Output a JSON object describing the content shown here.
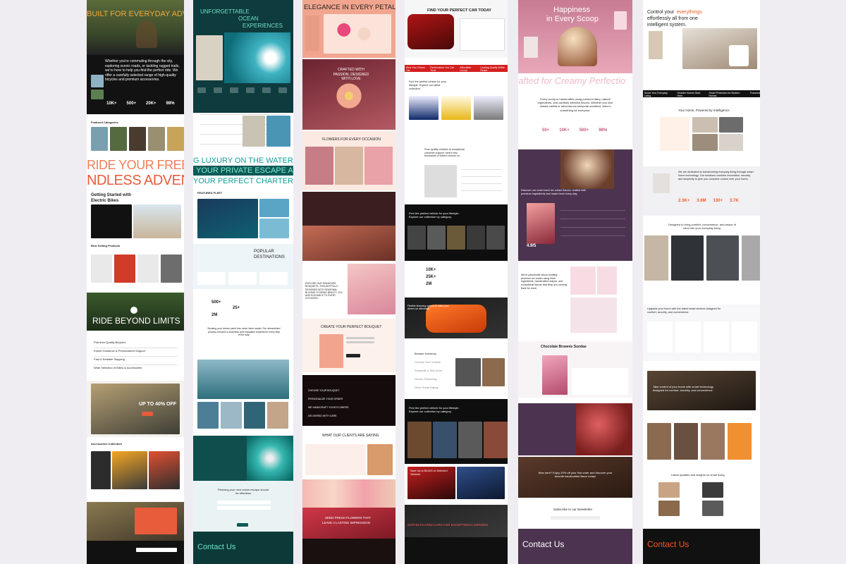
{
  "col1": {
    "hero": "BUILT FOR EVERYDAY ADVENT",
    "intro": "Whether you're commuting through the city, exploring scenic roads, or tackling rugged trails, we're here to help you find the perfect ride. We offer a carefully selected range of high-quality bicycles and premium accessories.",
    "stats": [
      "10K+",
      "500+",
      "20K+",
      "98%"
    ],
    "featured": "Featured Categories",
    "marquee1": "RIDE YOUR FREE",
    "marquee2": "NDLESS ADVEN",
    "getting_started": "Getting Started with Electric Bikes",
    "best_selling": "Best Selling Products",
    "ride_beyond": "RIDE BEYOND LIMITS",
    "why_list": [
      "Premium Quality Bicycles",
      "Expert Guidance & Personalized Support",
      "Fast & Reliable Shipping",
      "Wide Selection of Bikes & Accessories"
    ],
    "promo": "UP TO 40% OFF",
    "accessories": "Accessories Collection"
  },
  "col2": {
    "hero1": "UNFORGETTABLE",
    "hero2": "OCEAN",
    "hero3": "EXPERIENCES",
    "marquee1": "G LUXURY ON THE WATER",
    "marquee2": "YOUR PRIVATE ESCAPE AW",
    "marquee3": "YOUR PERFECT CHARTER",
    "fleet": "FEATURED FLEET",
    "popular1": "POPULAR",
    "popular2": "DESTINATIONS",
    "stats": [
      "500+",
      "25+",
      "2M"
    ],
    "booking": "Booking your dream yacht has never been easier. Our streamlined process ensures a seamless and enjoyable experience every step of the way.",
    "plan": "Planning your next ocean escape should be effortless",
    "contact": "Contact Us"
  },
  "col3": {
    "hero": "ELEGANCE IN EVERY PETAL",
    "crafted": "CRAFTED WITH PASSION, DESIGNED WITH LOVE",
    "occasion": "FLOWERS FOR EVERY OCCASION",
    "explore": "EXPLORE OUR SIGNATURE BOUQUETS, THOUGHTFULLY DESIGNED WITH SEASONAL BLOOMS TO BRING BEAUTY, JOY, AND ELEGANCE TO EVERY OCCASION.",
    "bouquet": "CREATE YOUR PERFECT BOUQUET",
    "steps": [
      "CHOOSE YOUR BOUQUET",
      "PERSONALIZE YOUR ORDER",
      "WE HANDCRAFT YOUR FLOWERS",
      "DELIVERED WITH CARE"
    ],
    "clients": "WHAT OUR CLIENTS ARE SAYING",
    "send1": "SEND FRESH FLOWERS THAT",
    "send2": "LEAVE A LASTING IMPRESSION"
  },
  "col4": {
    "hero": "FIND YOUR PERFECT CAR TODAY",
    "ticker": [
      "Rent Your Dream Car",
      "Performance You Can Trust",
      "Affordable Luxury",
      "Leading Quality Within Reach",
      "Premium Cars"
    ],
    "find": "Find the perfect vehicle for your lifestyle. Explore our latest collection.",
    "trusted": "From quality vehicles to exceptional customer support, here's why thousands of drivers choose us.",
    "lifestyle": "Find the perfect vehicle for your lifestyle. Explore our collection by category.",
    "stats": [
      "10K+",
      "25K+",
      "2M"
    ],
    "flexible": "Flexible financing options to make your dream car affordable.",
    "menu": [
      "Browse Inventory",
      "Choose Your Vehicle",
      "Schedule a Test Drive",
      "Secure Financing",
      "Drive Home Happy"
    ],
    "offer": "Save Up to $3,000 on Selected Vehicles",
    "sophisticated": "SOPHISTICATED CARS FOR EXCEPTIONAL DRIVERS"
  },
  "col5": {
    "hero1": "Happiness",
    "hero2": "in Every Scoop",
    "ticker": "rafted for Creamy Perfectio",
    "about": "Every scoop is handcrafted using premium dairy, natural ingredients, and carefully selected flavors. Whether you love classic vanilla or adventurous seasonal creations, there's something for everyone.",
    "stats": [
      "50+",
      "10K+",
      "500+",
      "98%"
    ],
    "discover": "Discover our most loved ice cream flavors, crafted with premium ingredients and made fresh every day.",
    "rating": "4.9/5",
    "passion": "We're passionate about creating premium ice cream using fresh ingredients, handcrafted recipes, and exceptional flavors that keep you coming back for more.",
    "sundae": "Chocolate Brownie Sundae",
    "new_here": "New here? Enjoy 20% off your first order and discover your favorite handcrafted flavor today!",
    "newsletter": "Subscribe to our Newsletter",
    "contact": "Contact Us"
  },
  "col6": {
    "hero1": "Control your",
    "hero_accent": "everythings",
    "hero2": "effortlessly all from one",
    "hero3": "intelligent system.",
    "ticker": [
      "Smart Your Everyday Living",
      "Smarter Homes Start Here",
      "Smart Protection for Modern Homes",
      "Powered"
    ],
    "intel": "Your Home, Powered by Intelligence",
    "dedicated": "We are dedicated to transforming everyday living through smart home technology. Our solutions combine innovation, security, and simplicity to give you complete control over your home.",
    "stats": [
      "2.3K+",
      "3.6M",
      "130+",
      "3.7K"
    ],
    "designed": "Designed to bring comfort, convenience, and peace of mind into your everyday living.",
    "upgrade": "Upgrade your home with the latest smart devices designed for comfort, security, and convenience.",
    "take_control": "Take control of your home with smart technology designed for comfort, security, and convenience.",
    "insights": "Latest updates and insights on smart living",
    "contact": "Contact Us"
  },
  "colors": {
    "bg": "#efedf1",
    "bike_accent": "#e85b3b",
    "ocean_teal": "#0e5a58",
    "flower_peach": "#f2a58e",
    "car_red": "#d41f1f",
    "ice_purple": "#5a3d5c",
    "smart_orange": "#f05a22"
  }
}
